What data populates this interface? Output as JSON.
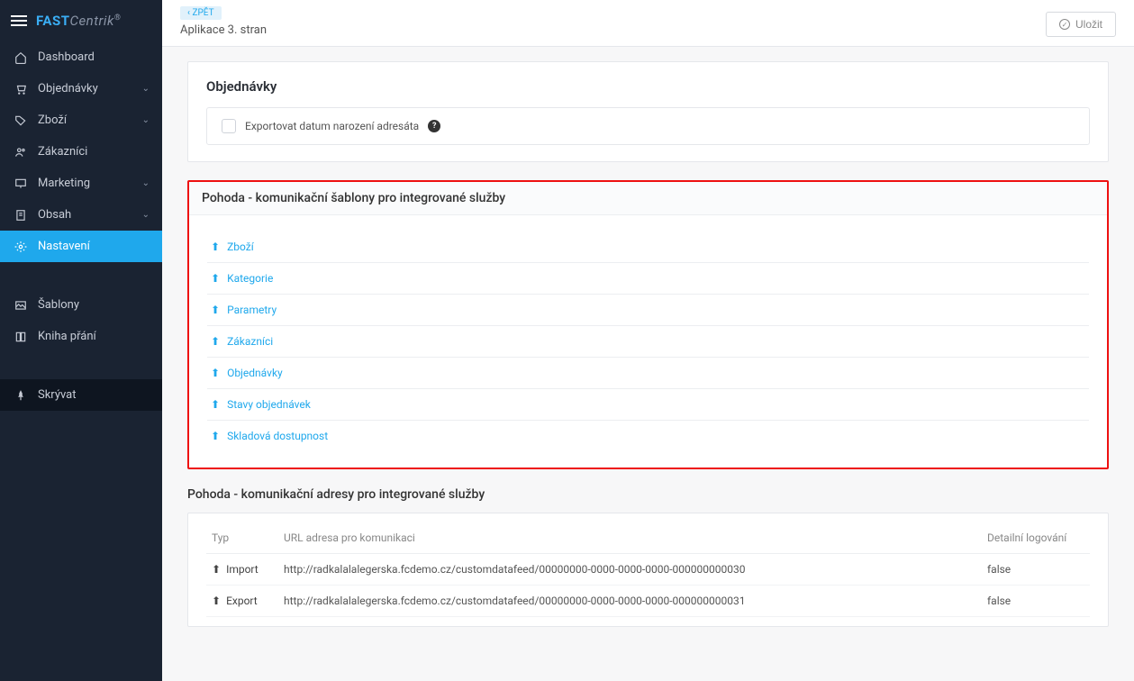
{
  "brand": {
    "main": "FAST",
    "sub": "Centrik",
    "reg": "®"
  },
  "topbar": {
    "back": "ZPĚT",
    "title": "Aplikace 3. stran",
    "save": "Uložit"
  },
  "nav": {
    "items": [
      {
        "label": "Dashboard",
        "expandable": false
      },
      {
        "label": "Objednávky",
        "expandable": true
      },
      {
        "label": "Zboží",
        "expandable": true
      },
      {
        "label": "Zákazníci",
        "expandable": false
      },
      {
        "label": "Marketing",
        "expandable": true
      },
      {
        "label": "Obsah",
        "expandable": true
      },
      {
        "label": "Nastavení",
        "expandable": false
      },
      {
        "label": "Šablony",
        "expandable": false
      },
      {
        "label": "Kniha přání",
        "expandable": false
      },
      {
        "label": "Skrývat",
        "expandable": false
      }
    ]
  },
  "orders": {
    "title": "Objednávky",
    "checkbox_label": "Exportovat datum narození adresáta"
  },
  "templates": {
    "title": "Pohoda - komunikační šablony pro integrované služby",
    "items": [
      "Zboží",
      "Kategorie",
      "Parametry",
      "Zákazníci",
      "Objednávky",
      "Stavy objednávek",
      "Skladová dostupnost"
    ]
  },
  "addresses": {
    "title": "Pohoda - komunikační adresy pro integrované služby",
    "columns": {
      "typ": "Typ",
      "url": "URL adresa pro komunikaci",
      "log": "Detailní logování"
    },
    "rows": [
      {
        "typ": "Import",
        "url": "http://radkalalalegerska.fcdemo.cz/customdatafeed/00000000-0000-0000-0000-000000000030",
        "log": "false"
      },
      {
        "typ": "Export",
        "url": "http://radkalalalegerska.fcdemo.cz/customdatafeed/00000000-0000-0000-0000-000000000031",
        "log": "false"
      }
    ]
  }
}
